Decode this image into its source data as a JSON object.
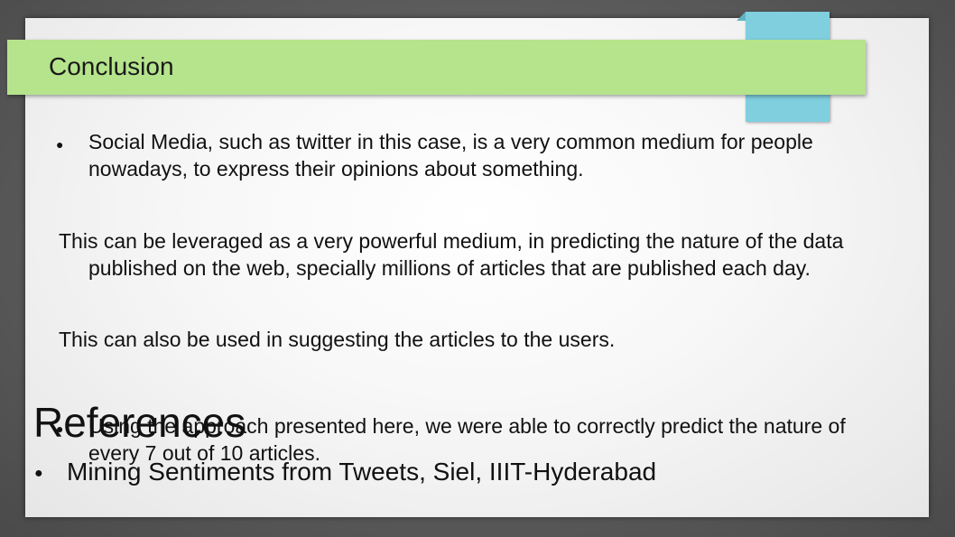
{
  "slide": {
    "title": "Conclusion",
    "bullet_1": "Social Media, such as twitter in this case, is a very common medium for people nowadays, to express their opinions about something.",
    "paragraph_1": "This can be leveraged as a very powerful medium, in predicting the nature of the data published on the web, specially millions of articles that are published each day.",
    "paragraph_2": "This can also be used in suggesting the articles to the users.",
    "bullet_2": "Using the approach presented here, we were able to correctly predict the nature of every 7 out of 10 articles.",
    "bullet_glyph": "●"
  },
  "references": {
    "heading": "References",
    "items": [
      "Mining Sentiments from Tweets, Siel, IIIT-Hyderabad"
    ]
  },
  "colors": {
    "title_bar": "#b5e48c",
    "accent": "#7fcfdf",
    "background": "#5c5c5c"
  }
}
